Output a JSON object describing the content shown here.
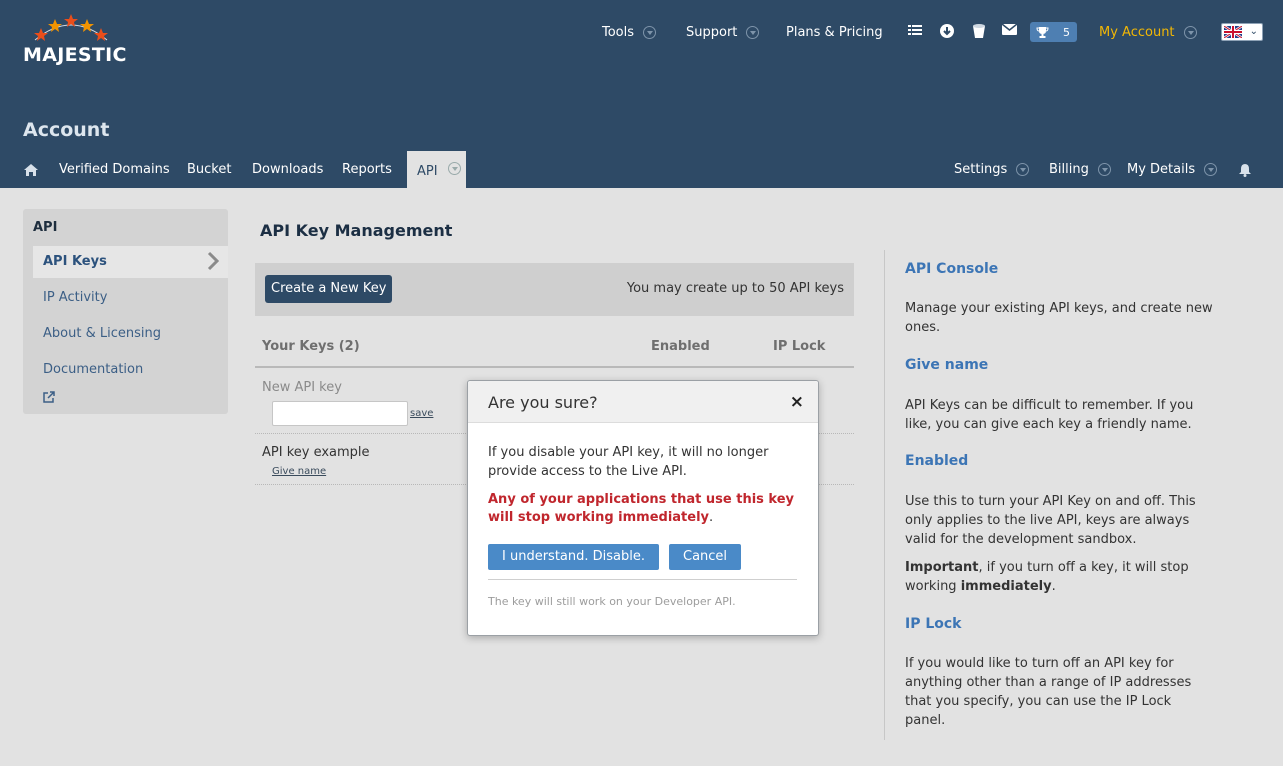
{
  "brand": {
    "logo_text": "MAJESTIC"
  },
  "topnav": {
    "tools": "Tools",
    "support": "Support",
    "plans": "Plans & Pricing",
    "trophy_count": "5",
    "my_account": "My Account",
    "language": "en-GB"
  },
  "page": {
    "title": "Account"
  },
  "subnav": {
    "items": [
      "Verified Domains",
      "Bucket",
      "Downloads",
      "Reports",
      "API"
    ],
    "right": [
      "Settings",
      "Billing",
      "My Details"
    ]
  },
  "sidebar": {
    "header": "API",
    "items": [
      "API Keys",
      "IP Activity",
      "About & Licensing",
      "Documentation"
    ]
  },
  "main": {
    "title": "API Key Management",
    "create_button": "Create a New Key",
    "create_note": "You may create up to 50 API keys",
    "columns": [
      "Your Keys (2)",
      "Enabled",
      "IP Lock"
    ],
    "new_key_label": "New API key",
    "save_link": "save",
    "example_label": "API key example",
    "give_name_link": "Give name"
  },
  "info": {
    "sections": [
      {
        "title": "API Console",
        "text": "Manage your existing API keys, and create new ones."
      },
      {
        "title": "Give name",
        "text": "API Keys can be difficult to remember. If you like, you can give each key a friendly name."
      },
      {
        "title": "Enabled",
        "text": "Use this to turn your API Key on and off. This only applies to the live API, keys are always valid for the development sandbox."
      },
      {
        "title": "IP Lock",
        "text": "If you would like to turn off an API key for anything other than a range of IP addresses that you specify, you can use the IP Lock panel."
      }
    ],
    "important_lead": "Important",
    "important_mid": ", if you turn off a key, it will stop working ",
    "important_bold": "immediately",
    "important_end": "."
  },
  "modal": {
    "title": "Are you sure?",
    "close": "×",
    "body": "If you disable your API key, it will no longer provide access to the Live API.",
    "warning": "Any of your applications that use this key will stop working immediately",
    "warning_end": ".",
    "confirm": "I understand. Disable.",
    "cancel": "Cancel",
    "footer": "The key will still work on your Developer API."
  },
  "colors": {
    "header": "#2e4a66",
    "accent": "#3c75b5",
    "account": "#f2b705",
    "warning": "#c0262d"
  }
}
